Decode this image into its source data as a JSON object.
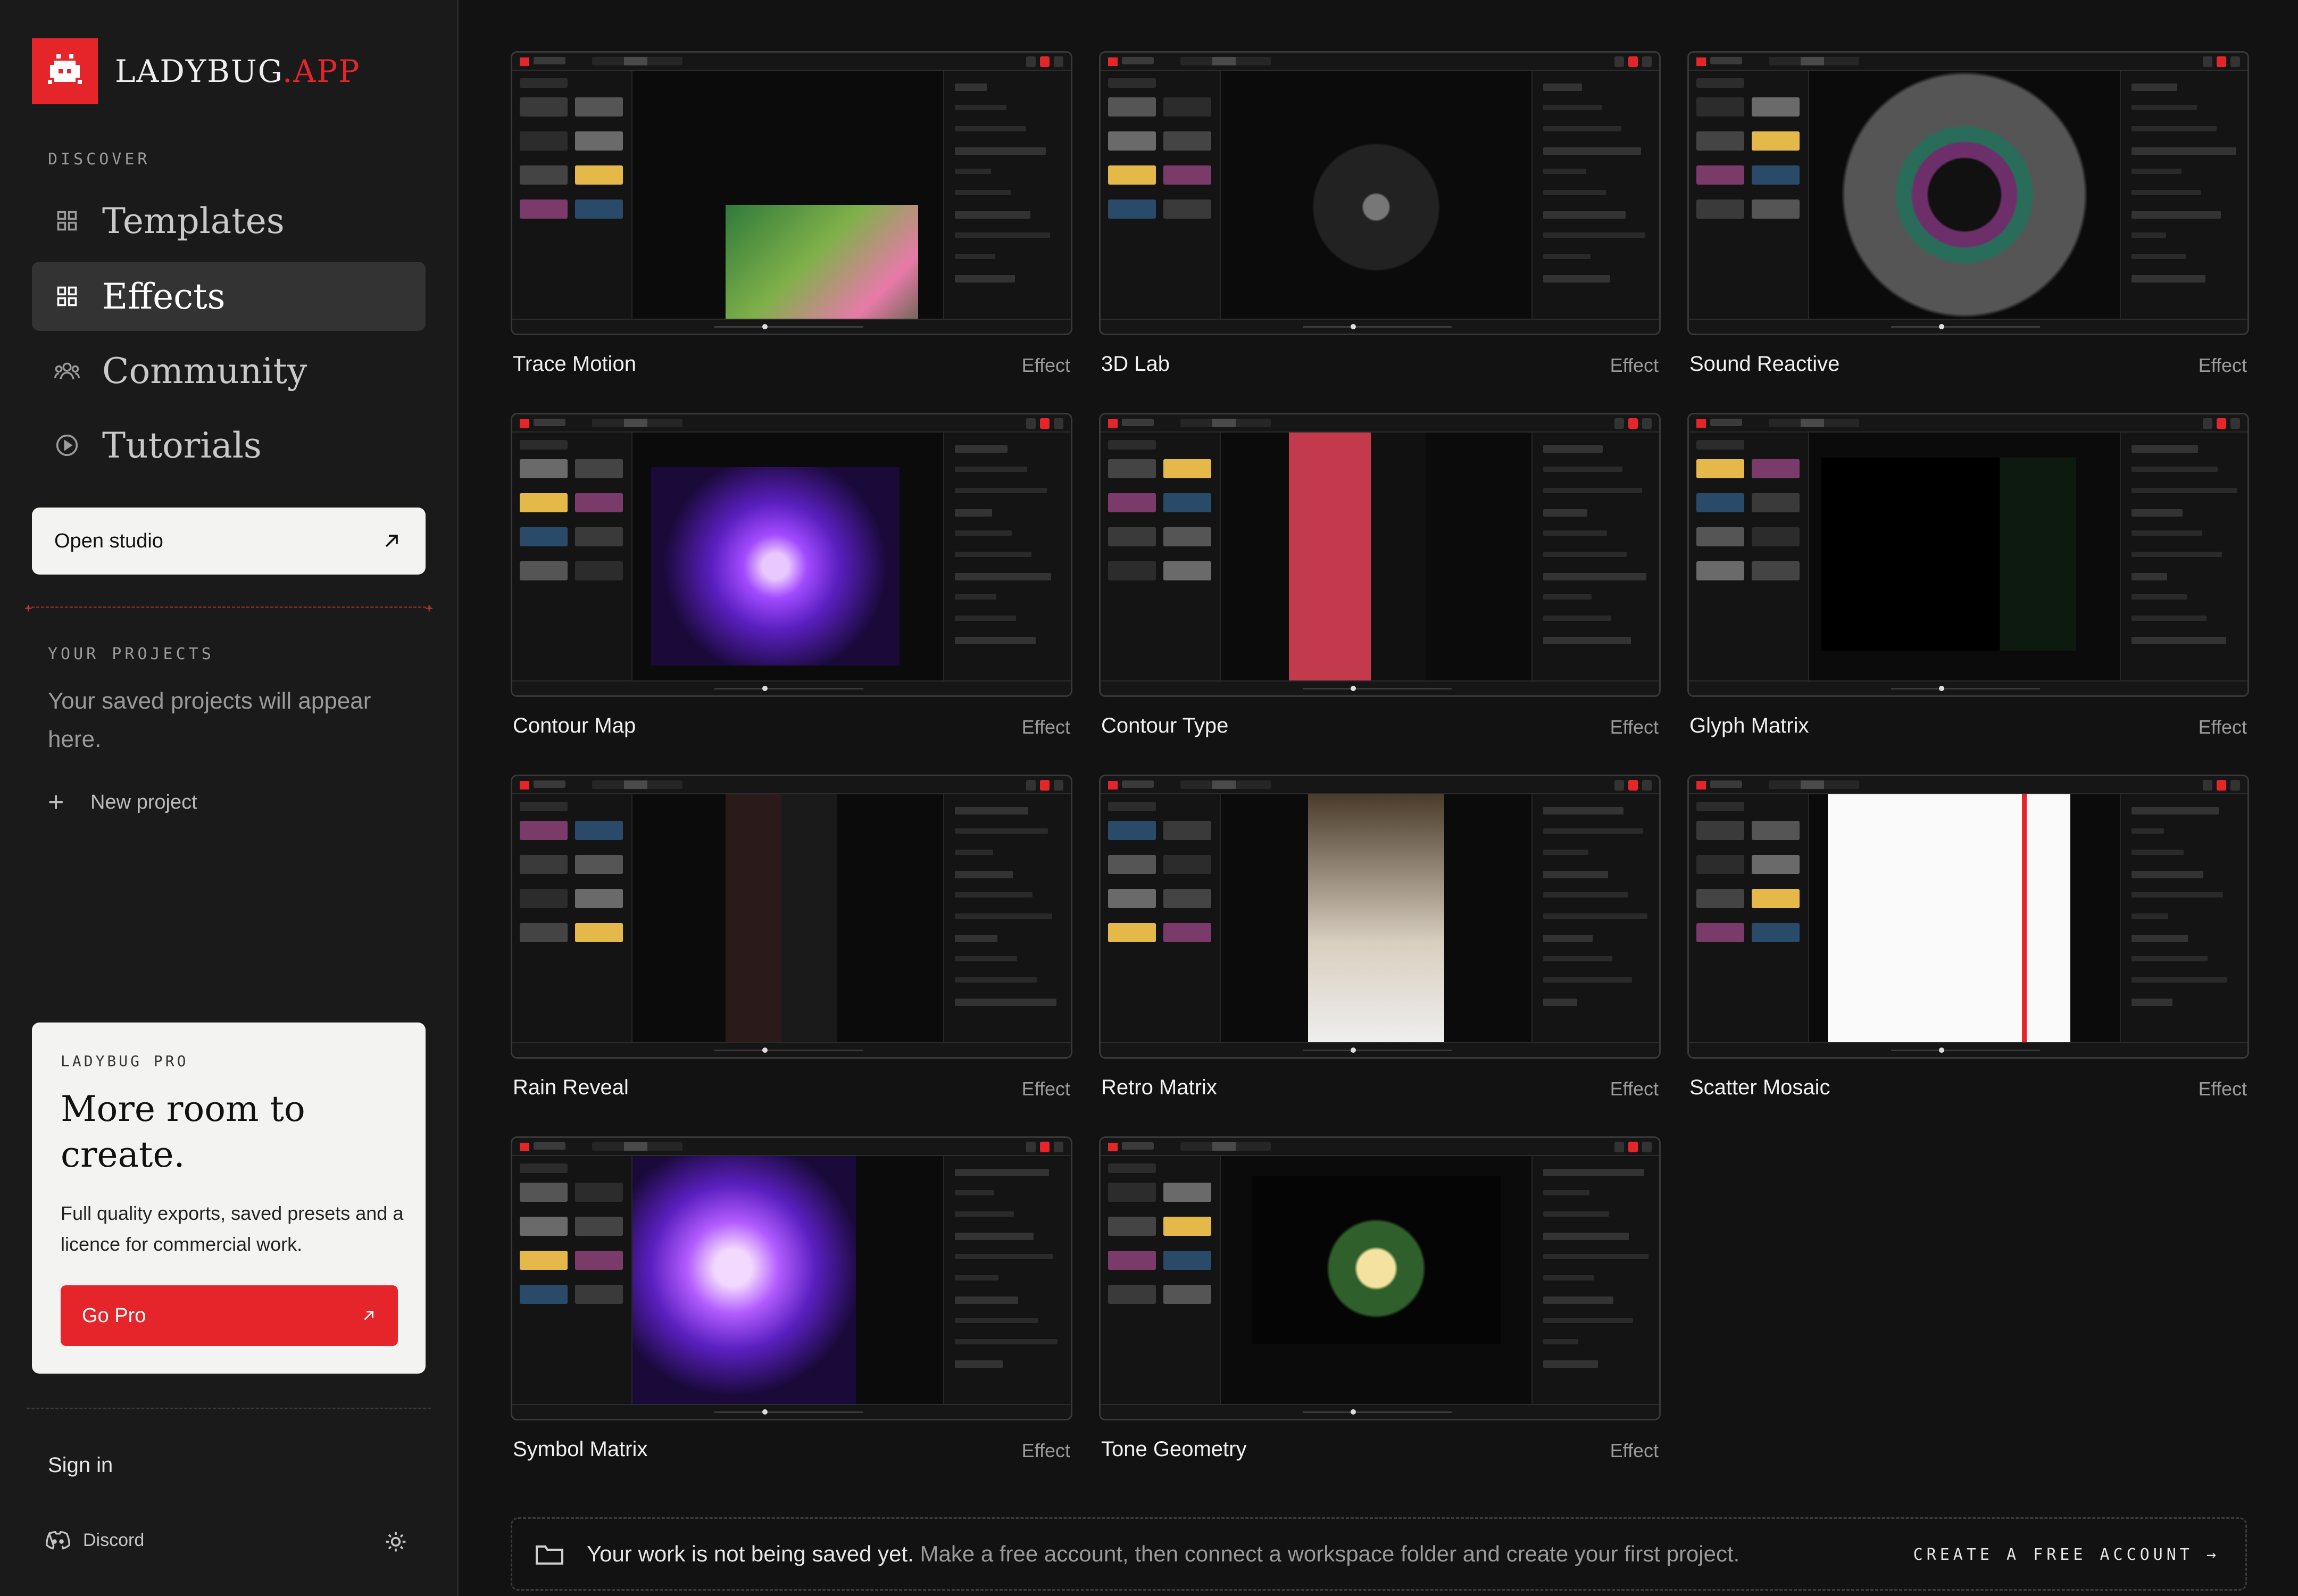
{
  "brand": {
    "name": "LADYBUG",
    "tld": ".APP",
    "accent": "#e5252a"
  },
  "sidebar": {
    "discover_label": "DISCOVER",
    "nav": [
      {
        "label": "Templates",
        "icon": "grid-icon",
        "active": false
      },
      {
        "label": "Effects",
        "icon": "grid-icon",
        "active": true
      },
      {
        "label": "Community",
        "icon": "people-icon",
        "active": false
      },
      {
        "label": "Tutorials",
        "icon": "play-circle-icon",
        "active": false
      }
    ],
    "open_studio_label": "Open studio",
    "projects_label": "YOUR PROJECTS",
    "projects_empty": "Your saved projects will appear here.",
    "new_project_label": "New project",
    "pro": {
      "eyebrow": "LADYBUG PRO",
      "title": "More room to create.",
      "description": "Full quality exports, saved presets and a licence for commercial work.",
      "button_label": "Go Pro"
    },
    "sign_in_label": "Sign in",
    "discord_label": "Discord"
  },
  "effects": [
    {
      "title": "Trace Motion",
      "type": "Effect"
    },
    {
      "title": "3D Lab",
      "type": "Effect"
    },
    {
      "title": "Sound Reactive",
      "type": "Effect"
    },
    {
      "title": "Contour Map",
      "type": "Effect"
    },
    {
      "title": "Contour Type",
      "type": "Effect"
    },
    {
      "title": "Glyph Matrix",
      "type": "Effect"
    },
    {
      "title": "Rain Reveal",
      "type": "Effect"
    },
    {
      "title": "Retro Matrix",
      "type": "Effect"
    },
    {
      "title": "Scatter Mosaic",
      "type": "Effect"
    },
    {
      "title": "Symbol Matrix",
      "type": "Effect"
    },
    {
      "title": "Tone Geometry",
      "type": "Effect"
    }
  ],
  "notice": {
    "strong": "Your work is not being saved yet.",
    "rest": " Make a free account, then connect a workspace folder and create your first project.",
    "cta": "CREATE A FREE ACCOUNT →"
  }
}
